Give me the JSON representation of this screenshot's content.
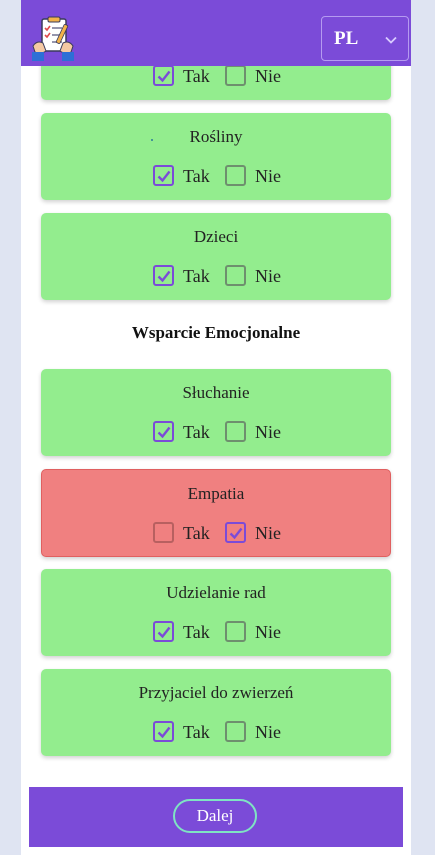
{
  "header": {
    "language": "PL"
  },
  "options": {
    "yes": "Tak",
    "no": "Nie"
  },
  "cards_top": [
    {
      "title": "",
      "yes_checked": true,
      "no_checked": false
    },
    {
      "title": "Rośliny",
      "yes_checked": true,
      "no_checked": false
    },
    {
      "title": "Dzieci",
      "yes_checked": true,
      "no_checked": false
    }
  ],
  "section": {
    "title": "Wsparcie Emocjonalne"
  },
  "cards_emotional": [
    {
      "title": "Słuchanie",
      "yes_checked": true,
      "no_checked": false
    },
    {
      "title": "Empatia",
      "yes_checked": false,
      "no_checked": true
    },
    {
      "title": "Udzielanie rad",
      "yes_checked": true,
      "no_checked": false
    },
    {
      "title": "Przyjaciel do zwierzeń",
      "yes_checked": true,
      "no_checked": false
    }
  ],
  "footer": {
    "next_label": "Dalej"
  },
  "colors": {
    "primary": "#7b4bd8",
    "card_ok": "#93ed8e",
    "card_bad": "#f08080",
    "background": "#dfe4f2"
  }
}
